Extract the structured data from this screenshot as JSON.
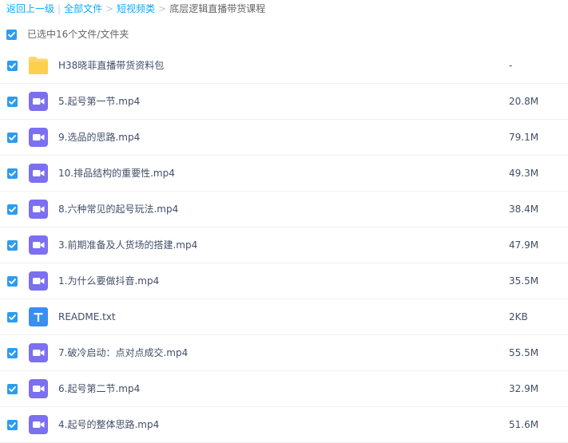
{
  "breadcrumb": {
    "back": "返回上一级",
    "all_files": "全部文件",
    "folder": "短视频类",
    "current": "底层逻辑直播带货课程"
  },
  "selection": {
    "label": "已选中16个文件/文件夹"
  },
  "files": [
    {
      "name": "H38晓菲直播带货资料包",
      "size": "-",
      "type": "folder"
    },
    {
      "name": "5.起号第一节.mp4",
      "size": "20.8M",
      "type": "video"
    },
    {
      "name": "9.选品的思路.mp4",
      "size": "79.1M",
      "type": "video"
    },
    {
      "name": "10.排品结构的重要性.mp4",
      "size": "49.3M",
      "type": "video"
    },
    {
      "name": "8.六种常见的起号玩法.mp4",
      "size": "38.4M",
      "type": "video"
    },
    {
      "name": "3.前期准备及人货场的搭建.mp4",
      "size": "47.9M",
      "type": "video"
    },
    {
      "name": "1.为什么要做抖音.mp4",
      "size": "35.5M",
      "type": "video"
    },
    {
      "name": "README.txt",
      "size": "2KB",
      "type": "text"
    },
    {
      "name": "7.破冷启动：点对点成交.mp4",
      "size": "55.5M",
      "type": "video"
    },
    {
      "name": "6.起号第二节.mp4",
      "size": "32.9M",
      "type": "video"
    },
    {
      "name": "4.起号的整体思路.mp4",
      "size": "51.6M",
      "type": "video"
    }
  ],
  "colors": {
    "link": "#09aaff",
    "checkbox": "#2d9cf0",
    "folder": "#fdd76b",
    "video": "#7c6ff0",
    "text": "#3a8ef0"
  }
}
